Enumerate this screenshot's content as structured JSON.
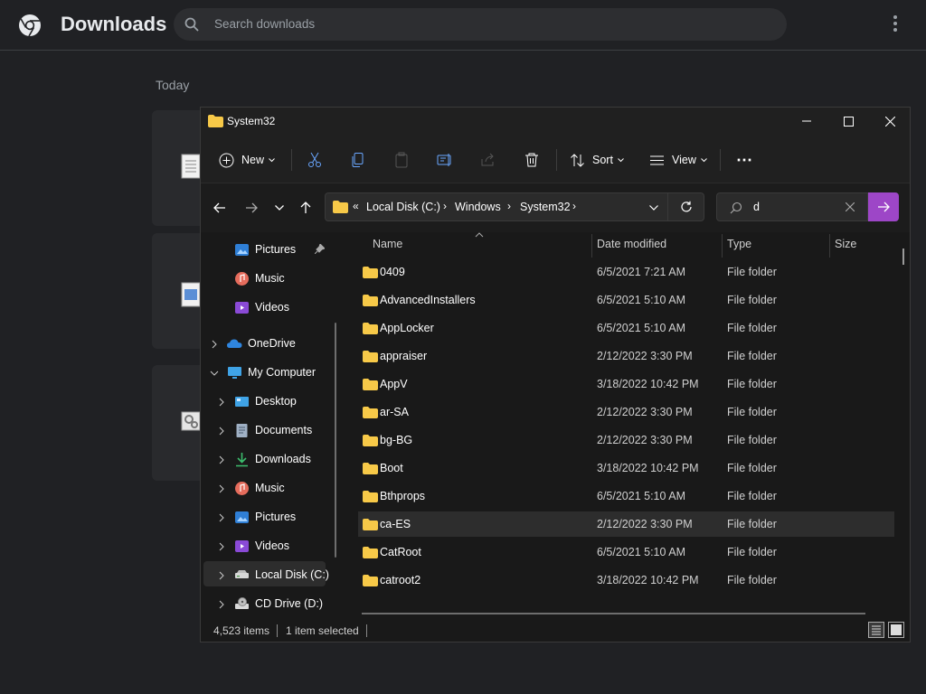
{
  "chrome": {
    "title": "Downloads",
    "search_placeholder": "Search downloads",
    "section_today": "Today"
  },
  "explorer": {
    "window_title": "System32",
    "toolbar": {
      "new_label": "New",
      "sort_label": "Sort",
      "view_label": "View",
      "more_label": "⋯"
    },
    "address": {
      "overflow": "«",
      "crumbs": [
        "Local Disk (C:)",
        "Windows",
        "System32"
      ]
    },
    "search_value": "d",
    "sidebar": {
      "items": [
        "Pictures",
        "Music",
        "Videos",
        "OneDrive",
        "My Computer",
        "Desktop",
        "Documents",
        "Downloads",
        "Music",
        "Pictures",
        "Videos",
        "Local Disk (C:)",
        "CD Drive (D:)"
      ]
    },
    "columns": [
      "Name",
      "Date modified",
      "Type",
      "Size"
    ],
    "rows": [
      {
        "name": "0409",
        "date": "6/5/2021 7:21 AM",
        "type": "File folder"
      },
      {
        "name": "AdvancedInstallers",
        "date": "6/5/2021 5:10 AM",
        "type": "File folder"
      },
      {
        "name": "AppLocker",
        "date": "6/5/2021 5:10 AM",
        "type": "File folder"
      },
      {
        "name": "appraiser",
        "date": "2/12/2022 3:30 PM",
        "type": "File folder"
      },
      {
        "name": "AppV",
        "date": "3/18/2022 10:42 PM",
        "type": "File folder"
      },
      {
        "name": "ar-SA",
        "date": "2/12/2022 3:30 PM",
        "type": "File folder"
      },
      {
        "name": "bg-BG",
        "date": "2/12/2022 3:30 PM",
        "type": "File folder"
      },
      {
        "name": "Boot",
        "date": "3/18/2022 10:42 PM",
        "type": "File folder"
      },
      {
        "name": "Bthprops",
        "date": "6/5/2021 5:10 AM",
        "type": "File folder"
      },
      {
        "name": "ca-ES",
        "date": "2/12/2022 3:30 PM",
        "type": "File folder"
      },
      {
        "name": "CatRoot",
        "date": "6/5/2021 5:10 AM",
        "type": "File folder"
      },
      {
        "name": "catroot2",
        "date": "3/18/2022 10:42 PM",
        "type": "File folder"
      }
    ],
    "status": {
      "item_count": "4,523 items",
      "selection": "1 item selected"
    }
  },
  "colors": {
    "search_go": "#9d46c7",
    "folder": "#f7c948"
  }
}
